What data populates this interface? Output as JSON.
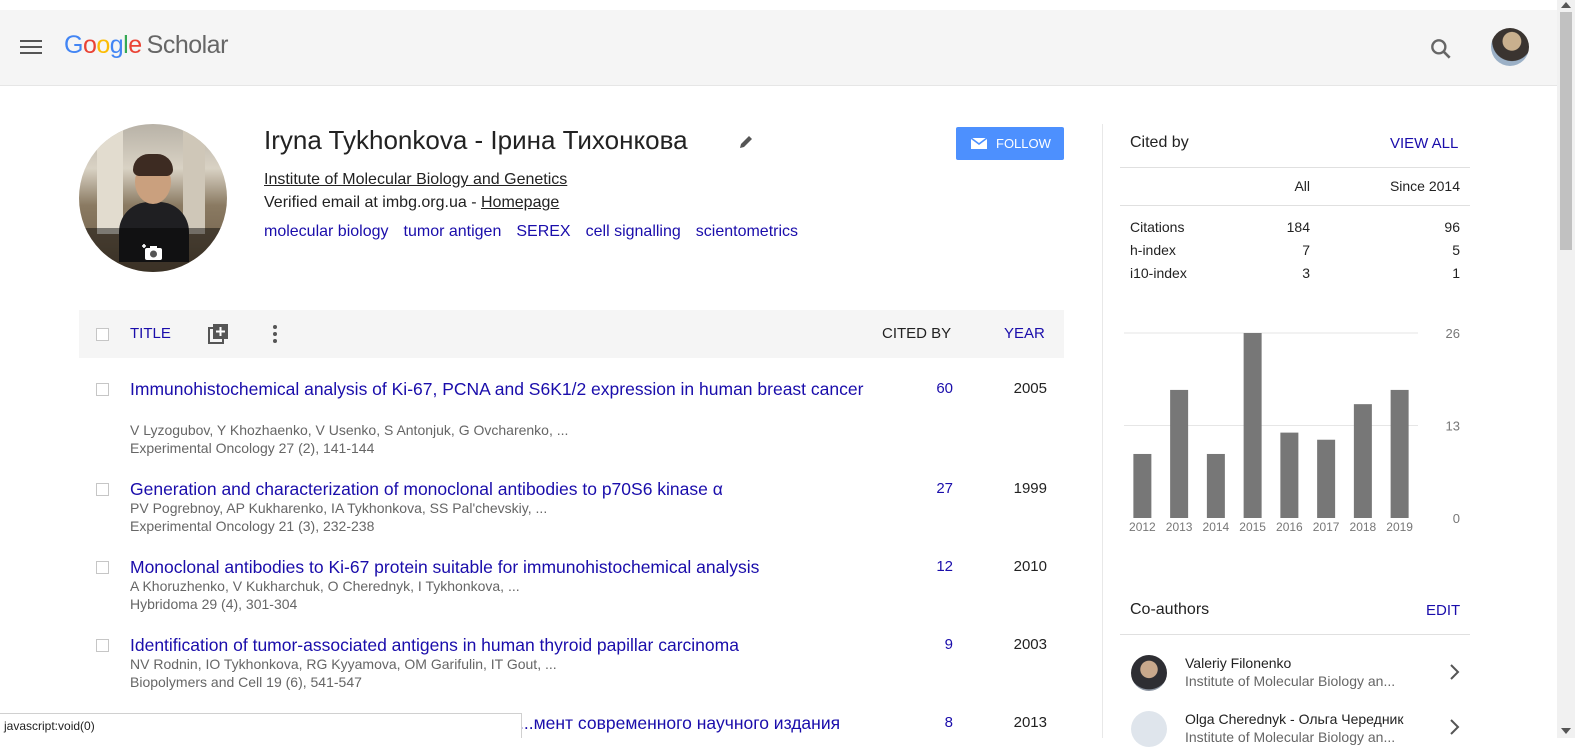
{
  "header": {
    "logo_text": "Google",
    "product": "Scholar"
  },
  "profile": {
    "name": "Iryna Tykhonkova - Ірина Тихонкова",
    "affiliation": "Institute of Molecular Biology and Genetics",
    "email_text": "Verified email at imbg.org.ua - ",
    "homepage_label": "Homepage",
    "interests": [
      "molecular biology",
      "tumor antigen",
      "SEREX",
      "cell signalling",
      "scientometrics"
    ],
    "follow_label": "FOLLOW"
  },
  "table": {
    "col_title": "TITLE",
    "col_cited": "CITED BY",
    "col_year": "YEAR",
    "rows": [
      {
        "title": "Immunohistochemical analysis of Ki-67, PCNA and S6K1/2 expression in human breast cancer",
        "authors": "V Lyzogubov, Y Khozhaenko, V Usenko, S Antonjuk, G Ovcharenko, ...",
        "venue": "Experimental Oncology 27 (2), 141-144",
        "cited": "60",
        "year": "2005"
      },
      {
        "title": "Generation and characterization of monoclonal antibodies to p70S6 kinase α",
        "authors": "PV Pogrebnoy, AP Kukharenko, IA Tykhonkova, SS Pal'chevskiy, ...",
        "venue": "Experimental Oncology 21 (3), 232-238",
        "cited": "27",
        "year": "1999"
      },
      {
        "title": "Monoclonal antibodies to Ki-67 protein suitable for immunohistochemical analysis",
        "authors": "A Khoruzhenko, V Kukharchuk, O Cherednyk, I Tykhonkova, ...",
        "venue": "Hybridoma 29 (4), 301-304",
        "cited": "12",
        "year": "2010"
      },
      {
        "title": "Identification of tumor-associated antigens in human thyroid papillar carcinoma",
        "authors": "NV Rodnin, IO Tykhonkova, RG Kyyamova, OM Garifulin, IT Gout, ...",
        "venue": "Biopolymers and Cell 19 (6), 541-547",
        "cited": "9",
        "year": "2003"
      },
      {
        "title": "...мент современного научного издания",
        "cited": "8",
        "year": "2013"
      }
    ]
  },
  "status_bar": "javascript:void(0)",
  "cited_by": {
    "title": "Cited by",
    "view_all": "VIEW ALL",
    "col_all": "All",
    "col_since": "Since 2014",
    "metrics": [
      {
        "label": "Citations",
        "all": "184",
        "since": "96"
      },
      {
        "label": "h-index",
        "all": "7",
        "since": "5"
      },
      {
        "label": "i10-index",
        "all": "3",
        "since": "1"
      }
    ]
  },
  "chart_data": {
    "type": "bar",
    "categories": [
      "2012",
      "2013",
      "2014",
      "2015",
      "2016",
      "2017",
      "2018",
      "2019"
    ],
    "values": [
      9,
      18,
      9,
      26,
      12,
      11,
      16,
      18
    ],
    "yticks": [
      "0",
      "13",
      "26"
    ],
    "ylim": [
      0,
      26
    ],
    "bar_color": "#777777"
  },
  "coauthors": {
    "title": "Co-authors",
    "edit": "EDIT",
    "items": [
      {
        "name": "Valeriy Filonenko",
        "institution": "Institute of Molecular Biology an..."
      },
      {
        "name": "Olga Cherednyk - Ольга Чередник",
        "institution": "Institute of Molecular Biology an..."
      }
    ]
  },
  "colors": {
    "link": "#1a0dab",
    "follow_button": "#4d90fe",
    "header_bg": "#f5f5f5"
  }
}
